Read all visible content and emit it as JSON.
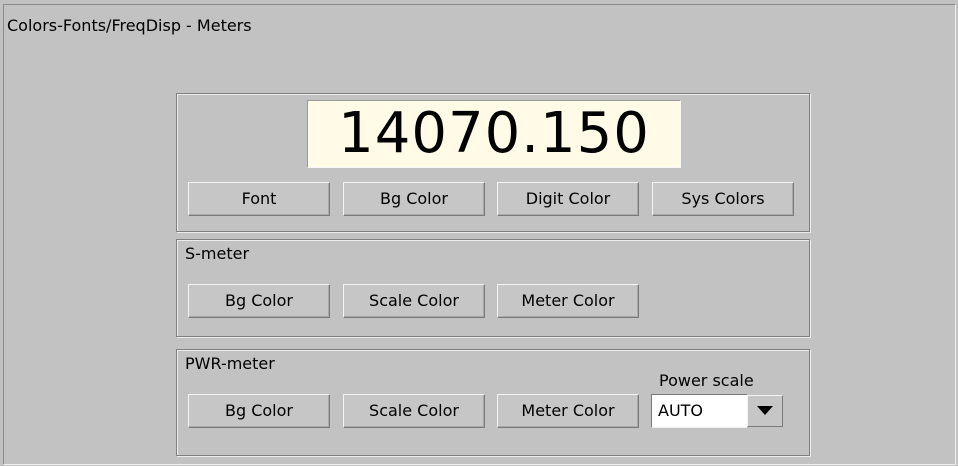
{
  "page": {
    "title": "Colors-Fonts/FreqDisp - Meters"
  },
  "freq_display": {
    "value": "14070.150",
    "background_color": "#fffbe6",
    "digit_color": "#000000",
    "buttons": {
      "font": "Font",
      "bg_color": "Bg Color",
      "digit_color": "Digit Color",
      "sys_colors": "Sys Colors"
    }
  },
  "s_meter": {
    "label": "S-meter",
    "buttons": {
      "bg_color": "Bg Color",
      "scale_color": "Scale Color",
      "meter_color": "Meter Color"
    }
  },
  "pwr_meter": {
    "label": "PWR-meter",
    "buttons": {
      "bg_color": "Bg Color",
      "scale_color": "Scale Color",
      "meter_color": "Meter Color"
    },
    "power_scale": {
      "label": "Power scale",
      "selected": "AUTO",
      "icon": "chevron-down-icon"
    }
  },
  "colors": {
    "window_bg": "#c2c2c2",
    "button_bg": "#c6c6c6",
    "display_bg": "#fffbe6"
  }
}
